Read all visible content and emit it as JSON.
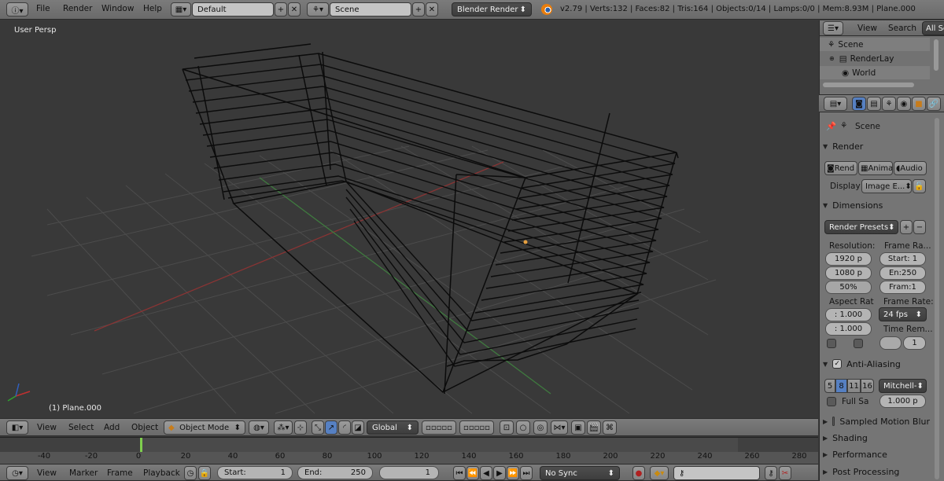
{
  "top_header": {
    "menus": [
      "File",
      "Render",
      "Window",
      "Help"
    ],
    "layout": "Default",
    "scene": "Scene",
    "engine": "Blender Render",
    "stats": "v2.79 | Verts:132 | Faces:82 | Tris:164 | Objects:0/14 | Lamps:0/0 | Mem:8.93M | Plane.000"
  },
  "viewport": {
    "label": "User Persp",
    "object_label": "(1) Plane.000"
  },
  "view3d_header": {
    "menus": [
      "View",
      "Select",
      "Add",
      "Object"
    ],
    "mode": "Object Mode",
    "orientation": "Global"
  },
  "timeline": {
    "ticks": [
      "-40",
      "-20",
      "0",
      "20",
      "40",
      "60",
      "80",
      "100",
      "120",
      "140",
      "160",
      "180",
      "200",
      "220",
      "240",
      "260",
      "280"
    ],
    "menus": [
      "View",
      "Marker",
      "Frame",
      "Playback"
    ],
    "start_label": "Start:",
    "start_value": "1",
    "end_label": "End:",
    "end_value": "250",
    "current": "1",
    "sync": "No Sync"
  },
  "outliner": {
    "menus": [
      "View",
      "Search"
    ],
    "filter": "All Sc",
    "items": [
      "Scene",
      "RenderLay",
      "World"
    ]
  },
  "properties": {
    "context": "Scene",
    "render": {
      "title": "Render",
      "buttons": [
        "Rend",
        "Anima",
        "Audio"
      ],
      "display_label": "Display",
      "display_value": "Image E..."
    },
    "dimensions": {
      "title": "Dimensions",
      "presets": "Render Presets",
      "resolution_label": "Resolution:",
      "res_x": "1920 p",
      "res_y": "1080 p",
      "res_pct": "50%",
      "frame_range_label": "Frame Ra...",
      "start": "Start: 1",
      "end": "En:250",
      "step": "Fram:1",
      "aspect_label": "Aspect Rat",
      "aspect_x": ": 1.000",
      "aspect_y": ": 1.000",
      "frame_rate_label": "Frame Rate:",
      "fps": "24 fps",
      "time_remap_label": "Time Rem...",
      "time_remap_value": "1"
    },
    "anti_aliasing": {
      "title": "Anti-Aliasing",
      "samples": [
        "5",
        "8",
        "11",
        "16"
      ],
      "filter": "Mitchell-",
      "full_sample": "Full Sa",
      "size": "1.000 p"
    },
    "collapsed": [
      "Sampled Motion Blur",
      "Shading",
      "Performance",
      "Post Processing"
    ]
  }
}
